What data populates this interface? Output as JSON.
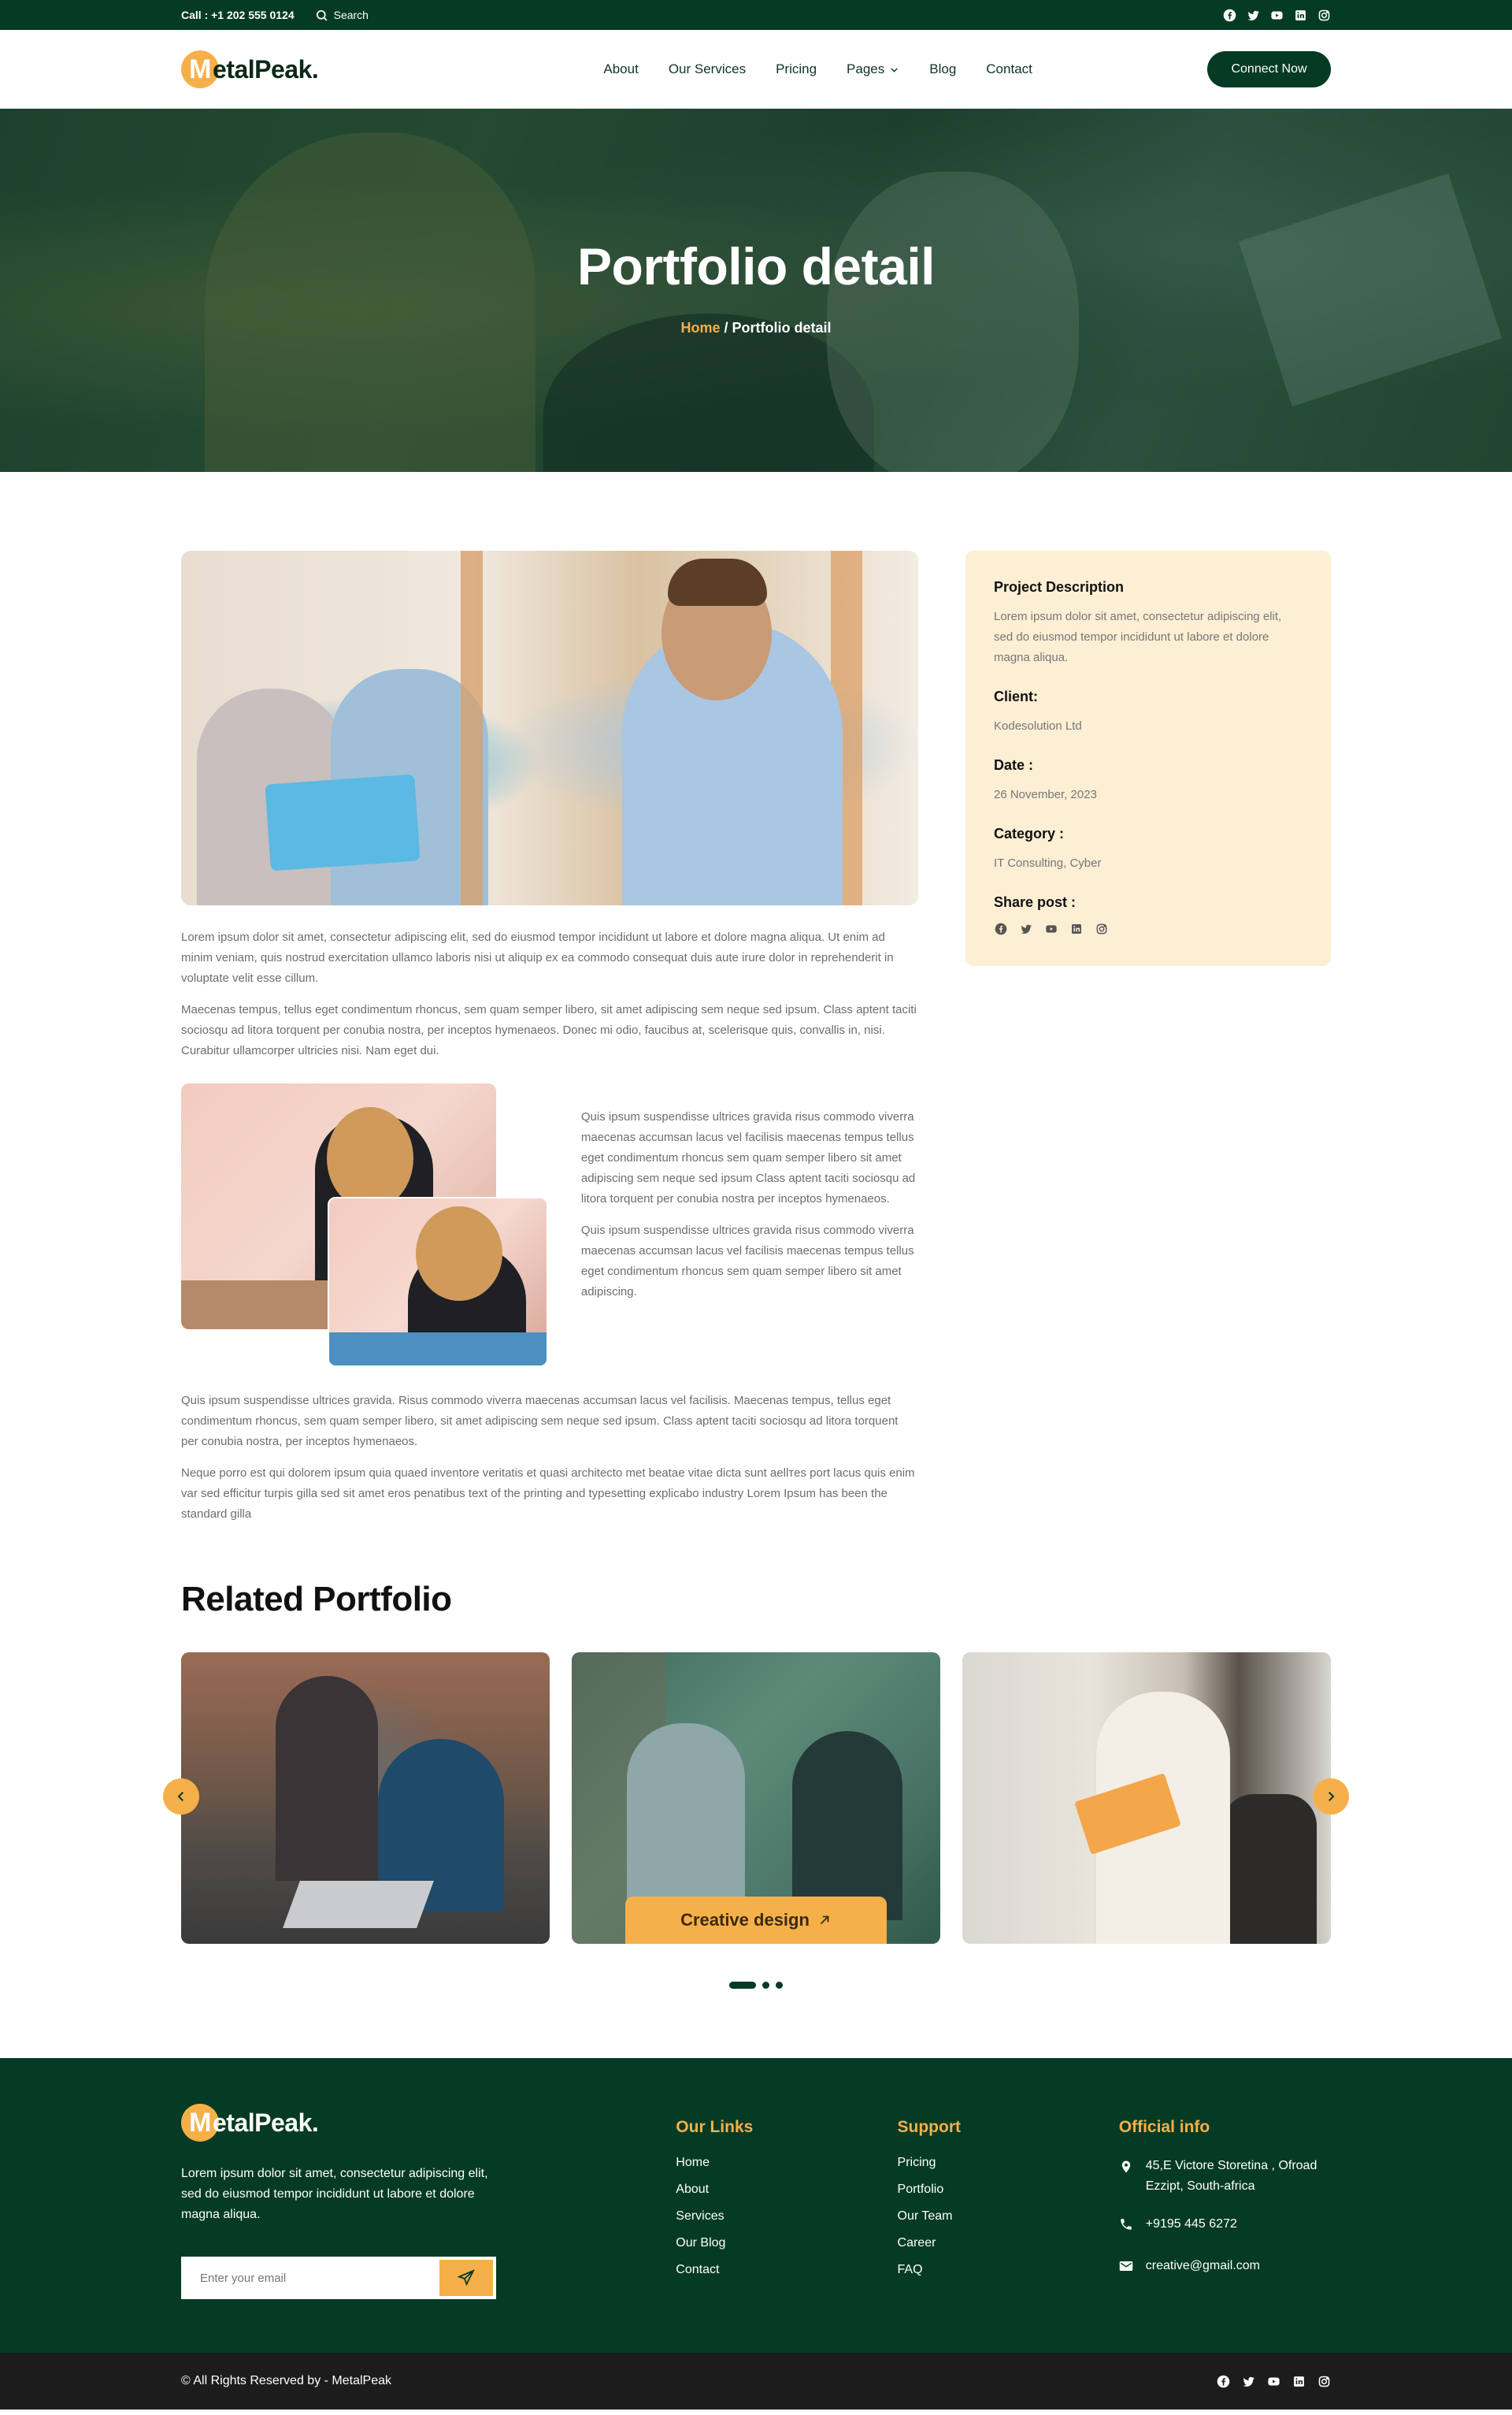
{
  "topbar": {
    "call": "Call : +1 202 555 0124",
    "search_label": "Search",
    "socials": [
      "facebook-icon",
      "twitter-icon",
      "youtube-icon",
      "linkedin-icon",
      "instagram-icon"
    ]
  },
  "brand": {
    "logo_initial": "M",
    "logo_rest": "etalPeak.",
    "accent": "#f6b04a",
    "primary": "#053b24"
  },
  "nav": {
    "items": [
      {
        "label": "About"
      },
      {
        "label": "Our Services"
      },
      {
        "label": "Pricing"
      },
      {
        "label": "Pages"
      },
      {
        "label": "Blog"
      },
      {
        "label": "Contact"
      }
    ],
    "cta": "Connect Now"
  },
  "hero": {
    "title": "Portfolio detail",
    "breadcrumb_home": "Home",
    "breadcrumb_sep": " / ",
    "breadcrumb_current": "Portfolio detail"
  },
  "content": {
    "p1": "Lorem ipsum dolor sit amet, consectetur adipiscing elit, sed do eiusmod tempor incididunt ut labore et dolore magna aliqua. Ut enim ad minim veniam, quis nostrud exercitation ullamco laboris nisi ut aliquip ex ea commodo consequat duis aute irure dolor in reprehenderit in voluptate velit esse cillum.",
    "p2": "Maecenas tempus, tellus eget condimentum rhoncus, sem quam semper libero, sit amet adipiscing sem neque sed ipsum. Class aptent taciti sociosqu ad litora torquent per conubia nostra, per inceptos hymenaeos. Donec mi odio, faucibus at, scelerisque quis, convallis in, nisi. Curabitur ullamcorper ultricies nisi. Nam eget dui.",
    "side_p1": "Quis ipsum suspendisse ultrices gravida risus commodo viverra maecenas accumsan lacus vel facilisis maecenas tempus tellus eget condimentum rhoncus sem quam semper libero sit amet adipiscing sem neque sed ipsum Class aptent taciti sociosqu ad litora torquent per conubia nostra per inceptos hymenaeos.",
    "side_p2": "Quis ipsum suspendisse ultrices gravida risus commodo viverra maecenas accumsan lacus vel facilisis maecenas tempus tellus eget condimentum rhoncus sem quam semper libero sit amet adipiscing.",
    "p3": "Quis ipsum suspendisse ultrices gravida. Risus commodo viverra maecenas accumsan lacus vel facilisis. Maecenas tempus, tellus eget condimentum rhoncus, sem quam semper libero, sit amet adipiscing sem neque sed ipsum. Class aptent taciti sociosqu ad litora torquent per conubia nostra, per inceptos hymenaeos.",
    "p4": "Neque porro est qui dolorem ipsum quia quaed inventore veritatis et quasi architecto met beatae vitae dicta sunt aellтes port lacus quis enim var sed efficitur turpis gilla sed sit amet eros penatibus text of the printing and typesetting explicabo industry Lorem Ipsum has been the standard gilla"
  },
  "sidebar": {
    "desc_title": "Project Description",
    "desc_text": "Lorem ipsum dolor sit amet, consectetur adipiscing elit, sed do eiusmod tempor incididunt ut labore et dolore magna aliqua.",
    "client_title": "Client:",
    "client_value": "Kodesolution Ltd",
    "date_title": "Date :",
    "date_value": "26 November, 2023",
    "category_title": "Category :",
    "category_value": "IT Consulting, Cyber",
    "share_title": "Share post :"
  },
  "related": {
    "title": "Related Portfolio",
    "card2_tag": "Creative design"
  },
  "footer": {
    "about": "Lorem ipsum dolor sit amet, consectetur adipiscing elit, sed do eiusmod tempor incididunt ut labore et dolore magna aliqua.",
    "email_placeholder": "Enter your email",
    "links_title": "Our Links",
    "links": [
      "Home",
      "About",
      "Services",
      "Our Blog",
      "Contact"
    ],
    "support_title": "Support",
    "support": [
      "Pricing",
      "Portfolio",
      "Our Team",
      "Career",
      "FAQ"
    ],
    "info_title": "Official info",
    "address": "45,E Victore Storetina , Ofroad Ezzipt, South-africa",
    "phone": "+9195 445 6272",
    "email": "creative@gmail.com",
    "copyright": "© All Rights Reserved by - MetalPeak"
  }
}
